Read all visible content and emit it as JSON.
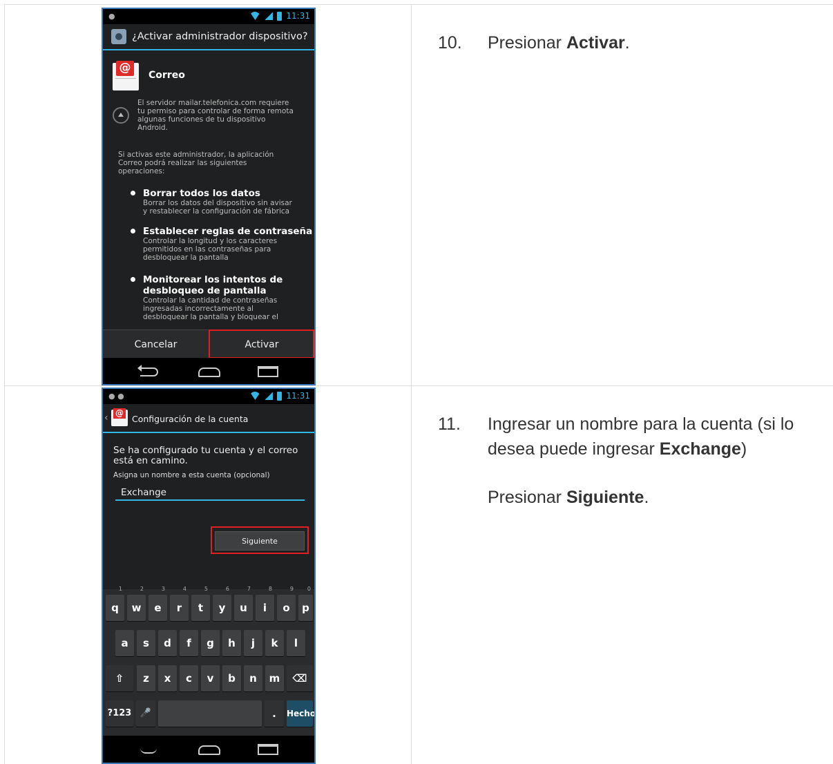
{
  "step10": {
    "number": "10.",
    "prefix": "Presionar ",
    "bold": "Activar",
    "suffix": "."
  },
  "step11": {
    "number": "11.",
    "line1": "Ingresar un nombre para la cuenta (si lo",
    "line2_prefix": "desea puede ingresar ",
    "line2_bold": "Exchange",
    "line2_suffix": ")",
    "line3_prefix": "Presionar ",
    "line3_bold": "Siguiente",
    "line3_suffix": "."
  },
  "screen1": {
    "time": "11:31",
    "dialog_title": "¿Activar administrador dispositivo?",
    "app_name": "Correo",
    "server_text": [
      "El servidor mailar.telefonica.com requiere",
      "tu permiso para controlar de forma remota",
      "algunas funciones de tu dispositivo",
      "Android."
    ],
    "intro_text": [
      "Si activas este administrador, la aplicación",
      "Correo podrá realizar las siguientes",
      "operaciones:"
    ],
    "permissions": [
      {
        "title": "Borrar todos los datos",
        "desc": [
          "Borrar los datos del dispositivo sin avisar",
          "y restablecer la configuración de fábrica"
        ]
      },
      {
        "title": "Establecer reglas de contraseña",
        "desc": [
          "Controlar la longitud y los caracteres",
          "permitidos en las contraseñas para",
          "desbloquear la pantalla"
        ]
      },
      {
        "title": "Monitorear los intentos de desbloqueo de pantalla",
        "title_lines": [
          "Monitorear los intentos de",
          "desbloqueo de pantalla"
        ],
        "desc": [
          "Controlar la cantidad de contraseñas",
          "ingresadas incorrectamente al",
          "desbloquear la pantalla y bloquear el"
        ]
      }
    ],
    "cancel_label": "Cancelar",
    "activate_label": "Activar"
  },
  "screen2": {
    "time": "11:31",
    "title": "Configuración de la cuenta",
    "message_line1": "Se ha configurado tu cuenta y el correo",
    "message_line2": "está en camino.",
    "hint": "Asigna un nombre a esta cuenta (opcional)",
    "input_value": "Exchange",
    "next_label": "Siguiente",
    "keyboard": {
      "row1": [
        "q",
        "w",
        "e",
        "r",
        "t",
        "y",
        "u",
        "i",
        "o",
        "p"
      ],
      "row1_nums": [
        "1",
        "2",
        "3",
        "4",
        "5",
        "6",
        "7",
        "8",
        "9",
        "0"
      ],
      "row2": [
        "a",
        "s",
        "d",
        "f",
        "g",
        "h",
        "j",
        "k",
        "l"
      ],
      "row3": [
        "z",
        "x",
        "c",
        "v",
        "b",
        "n",
        "m"
      ],
      "shift": "⇧",
      "backspace": "⌫",
      "symbols": "?123",
      "mic": "🎙",
      "period": ".",
      "done": "Hecho"
    }
  },
  "colors": {
    "accent_blue": "#33b5e5",
    "highlight_red": "#e02020"
  }
}
